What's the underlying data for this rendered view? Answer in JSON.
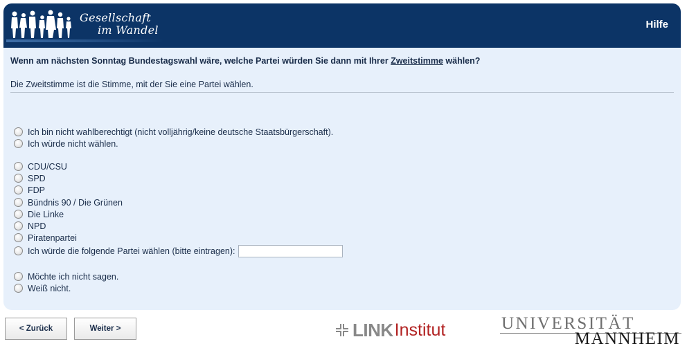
{
  "header": {
    "logo_line1": "Gesellschaft",
    "logo_line2": "im Wandel",
    "help_label": "Hilfe",
    "bg_color": "#0c3466"
  },
  "question": {
    "text_before": "Wenn am nächsten Sonntag Bundestagswahl wäre, welche Partei würden Sie dann mit Ihrer ",
    "link_text": "Zweitstimme",
    "text_after": " wählen?",
    "hint": "Die Zweitstimme ist die Stimme, mit der Sie eine Partei wählen."
  },
  "options": {
    "not_eligible": "Ich bin nicht wahlberechtigt (nicht volljährig/keine deutsche Staatsbürgerschaft).",
    "would_not_vote": "Ich würde nicht wählen.",
    "cdu_csu": "CDU/CSU",
    "spd": "SPD",
    "fdp": "FDP",
    "gruene": "Bündnis 90 / Die Grünen",
    "linke": "Die Linke",
    "npd": "NPD",
    "piraten": "Piratenpartei",
    "other_party": "Ich würde die folgende Partei wählen (bitte eintragen):",
    "other_party_value": "",
    "refuse": "Möchte ich nicht sagen.",
    "dont_know": "Weiß nicht."
  },
  "footer": {
    "back_label": "< Zurück",
    "next_label": "Weiter >",
    "link_logo_word": "LINK",
    "link_logo_institut": "Institut",
    "uni_line1": "UNIVERSITÄT",
    "uni_line2": "MANNHEIM"
  }
}
